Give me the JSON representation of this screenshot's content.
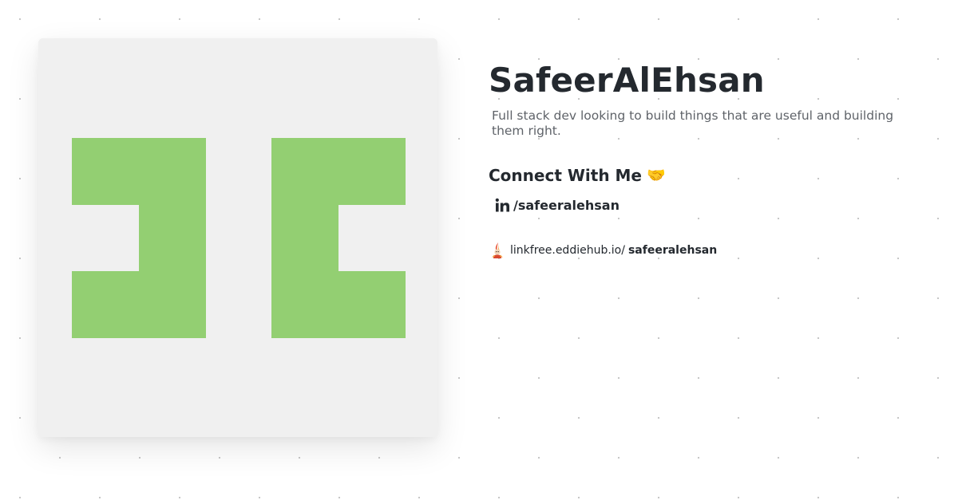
{
  "profile": {
    "name": "SafeerAlEhsan",
    "bio": "Full stack dev looking to build things that are useful and building them right.",
    "avatar": {
      "type": "identicon",
      "foreground_color": "#93cf72",
      "background_color": "#f0f0f0"
    }
  },
  "connect": {
    "heading": "Connect With Me",
    "emoji": "🤝"
  },
  "links": {
    "linkedin": {
      "icon": "linkedin-icon",
      "label": "/safeeralehsan"
    },
    "linkfree": {
      "icon": "linkfree-logo-icon",
      "domain": "linkfree.eddiehub.io/",
      "username": "safeeralehsan"
    }
  },
  "colors": {
    "text_primary": "#24292f",
    "text_secondary": "#5f6369",
    "page_background": "#ffffff",
    "dot_pattern": "#c4c4c4"
  }
}
